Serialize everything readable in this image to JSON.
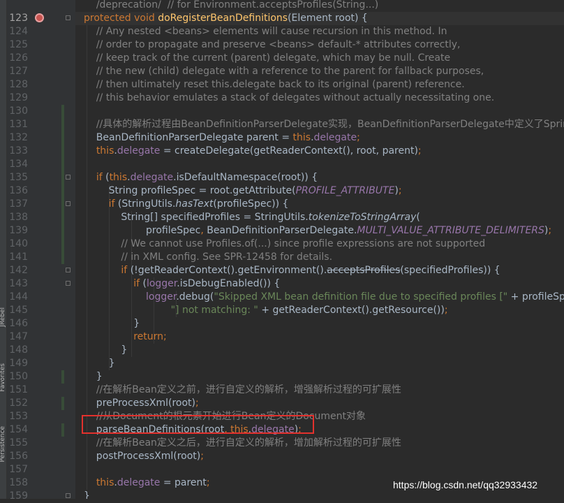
{
  "side_tabs": [
    "Favorites",
    "Persistence",
    "JRebel"
  ],
  "lines": [
    {
      "no": "",
      "segs": [
        {
          "t": "    "
        },
        {
          "t": "/deprecation/  // for Environment.acceptsProfiles(String...)",
          "c": "c"
        }
      ]
    },
    {
      "no": "123",
      "current": true,
      "breakpoint": true,
      "segs": [
        {
          "t": "protected ",
          "c": "k"
        },
        {
          "t": "void ",
          "c": "k"
        },
        {
          "t": "doRegisterBeanDefinitions",
          "c": "f"
        },
        {
          "t": "(Element root) {"
        }
      ]
    },
    {
      "no": "124",
      "segs": [
        {
          "t": "    "
        },
        {
          "t": "// Any nested <beans> elements will cause recursion in this method. In",
          "c": "c"
        }
      ]
    },
    {
      "no": "125",
      "segs": [
        {
          "t": "    "
        },
        {
          "t": "// order to propagate and preserve <beans> default-* attributes correctly,",
          "c": "c"
        }
      ]
    },
    {
      "no": "126",
      "segs": [
        {
          "t": "    "
        },
        {
          "t": "// keep track of the current (parent) delegate, which may be null. Create",
          "c": "c"
        }
      ]
    },
    {
      "no": "127",
      "segs": [
        {
          "t": "    "
        },
        {
          "t": "// the new (child) delegate with a reference to the parent for fallback purposes,",
          "c": "c"
        }
      ]
    },
    {
      "no": "128",
      "segs": [
        {
          "t": "    "
        },
        {
          "t": "// then ultimately reset this.delegate back to its original (parent) reference.",
          "c": "c"
        }
      ]
    },
    {
      "no": "129",
      "segs": [
        {
          "t": "    "
        },
        {
          "t": "// this behavior emulates a stack of delegates without actually necessitating one.",
          "c": "c"
        }
      ]
    },
    {
      "no": "130",
      "segs": []
    },
    {
      "no": "131",
      "segs": [
        {
          "t": "    "
        },
        {
          "t": "//具体的解析过程由BeanDefinitionParserDelegate实现，BeanDefinitionParserDelegate中定义了Spring",
          "c": "c"
        }
      ]
    },
    {
      "no": "132",
      "segs": [
        {
          "t": "    BeanDefinitionParserDelegate parent = "
        },
        {
          "t": "this",
          "c": "k"
        },
        {
          "t": "."
        },
        {
          "t": "delegate",
          "c": "fld"
        },
        {
          "t": ";",
          "c": "k"
        }
      ]
    },
    {
      "no": "133",
      "segs": [
        {
          "t": "    "
        },
        {
          "t": "this",
          "c": "k"
        },
        {
          "t": "."
        },
        {
          "t": "delegate",
          "c": "fld"
        },
        {
          "t": " = createDelegate(getReaderContext(), root, parent)"
        },
        {
          "t": ";",
          "c": "k"
        }
      ]
    },
    {
      "no": "134",
      "segs": []
    },
    {
      "no": "135",
      "segs": [
        {
          "t": "    "
        },
        {
          "t": "if ",
          "c": "k"
        },
        {
          "t": "("
        },
        {
          "t": "this",
          "c": "k"
        },
        {
          "t": "."
        },
        {
          "t": "delegate",
          "c": "fld"
        },
        {
          "t": ".isDefaultNamespace(root)) {"
        }
      ]
    },
    {
      "no": "136",
      "segs": [
        {
          "t": "        String profileSpec = root.getAttribute("
        },
        {
          "t": "PROFILE_ATTRIBUTE",
          "c": "sf"
        },
        {
          "t": ")"
        },
        {
          "t": ";",
          "c": "k"
        }
      ]
    },
    {
      "no": "137",
      "segs": [
        {
          "t": "        "
        },
        {
          "t": "if ",
          "c": "k"
        },
        {
          "t": "(StringUtils."
        },
        {
          "t": "hasText",
          "c": "it"
        },
        {
          "t": "(profileSpec)) {"
        }
      ]
    },
    {
      "no": "138",
      "segs": [
        {
          "t": "            String[] specifiedProfiles = StringUtils."
        },
        {
          "t": "tokenizeToStringArray",
          "c": "it"
        },
        {
          "t": "("
        }
      ]
    },
    {
      "no": "139",
      "segs": [
        {
          "t": "                    profileSpec"
        },
        {
          "t": ", ",
          "c": "k"
        },
        {
          "t": "BeanDefinitionParserDelegate."
        },
        {
          "t": "MULTI_VALUE_ATTRIBUTE_DELIMITERS",
          "c": "sf"
        },
        {
          "t": ")"
        },
        {
          "t": ";",
          "c": "k"
        }
      ]
    },
    {
      "no": "140",
      "segs": [
        {
          "t": "            "
        },
        {
          "t": "// We cannot use Profiles.of(...) since profile expressions are not supported",
          "c": "c"
        }
      ]
    },
    {
      "no": "141",
      "segs": [
        {
          "t": "            "
        },
        {
          "t": "// in XML config. See SPR-12458 for details.",
          "c": "c"
        }
      ]
    },
    {
      "no": "142",
      "segs": [
        {
          "t": "            "
        },
        {
          "t": "if ",
          "c": "k"
        },
        {
          "t": "(!getReaderContext().getEnvironment()."
        },
        {
          "t": "acceptsProfiles",
          "c": "dep"
        },
        {
          "t": "(specifiedProfiles)) {"
        }
      ]
    },
    {
      "no": "143",
      "segs": [
        {
          "t": "                "
        },
        {
          "t": "if ",
          "c": "k"
        },
        {
          "t": "("
        },
        {
          "t": "logger",
          "c": "fld"
        },
        {
          "t": ".isDebugEnabled()) {"
        }
      ]
    },
    {
      "no": "144",
      "segs": [
        {
          "t": "                    "
        },
        {
          "t": "logger",
          "c": "fld"
        },
        {
          "t": ".debug("
        },
        {
          "t": "\"Skipped XML bean definition file due to specified profiles [\"",
          "c": "s"
        },
        {
          "t": " + profileSpec +"
        }
      ]
    },
    {
      "no": "145",
      "segs": [
        {
          "t": "                            "
        },
        {
          "t": "\"] not matching: \"",
          "c": "s"
        },
        {
          "t": " + getReaderContext().getResource())"
        },
        {
          "t": ";",
          "c": "k"
        }
      ]
    },
    {
      "no": "146",
      "segs": [
        {
          "t": "                }"
        }
      ]
    },
    {
      "no": "147",
      "segs": [
        {
          "t": "                "
        },
        {
          "t": "return;",
          "c": "k"
        }
      ]
    },
    {
      "no": "148",
      "segs": [
        {
          "t": "            }"
        }
      ]
    },
    {
      "no": "149",
      "segs": [
        {
          "t": "        }"
        }
      ]
    },
    {
      "no": "150",
      "segs": [
        {
          "t": "    }"
        }
      ]
    },
    {
      "no": "151",
      "segs": [
        {
          "t": "    "
        },
        {
          "t": "//在解析Bean定义之前，进行自定义的解析，增强解析过程的可扩展性",
          "c": "c"
        }
      ]
    },
    {
      "no": "152",
      "segs": [
        {
          "t": "    preProcessXml(root)"
        },
        {
          "t": ";",
          "c": "k"
        }
      ]
    },
    {
      "no": "153",
      "segs": [
        {
          "t": "    "
        },
        {
          "t": "//从Document的根元素开始进行Bean定义的Document对象",
          "c": "c"
        }
      ]
    },
    {
      "no": "154",
      "segs": [
        {
          "t": "    parseBeanDefinitions(root"
        },
        {
          "t": ", ",
          "c": "k"
        },
        {
          "t": "this",
          "c": "k"
        },
        {
          "t": "."
        },
        {
          "t": "delegate",
          "c": "fld"
        },
        {
          "t": ")"
        },
        {
          "t": ";",
          "c": "k"
        }
      ]
    },
    {
      "no": "155",
      "segs": [
        {
          "t": "    "
        },
        {
          "t": "//在解析Bean定义之后，进行自定义的解析，增加解析过程的可扩展性",
          "c": "c"
        }
      ]
    },
    {
      "no": "156",
      "segs": [
        {
          "t": "    postProcessXml(root)"
        },
        {
          "t": ";",
          "c": "k"
        }
      ]
    },
    {
      "no": "157",
      "segs": []
    },
    {
      "no": "158",
      "segs": [
        {
          "t": "    "
        },
        {
          "t": "this",
          "c": "k"
        },
        {
          "t": "."
        },
        {
          "t": "delegate",
          "c": "fld"
        },
        {
          "t": " = parent"
        },
        {
          "t": ";",
          "c": "k"
        }
      ]
    },
    {
      "no": "159",
      "segs": [
        {
          "t": "}"
        }
      ]
    }
  ],
  "watermark": "https://blog.csdn.net/qq32933432"
}
